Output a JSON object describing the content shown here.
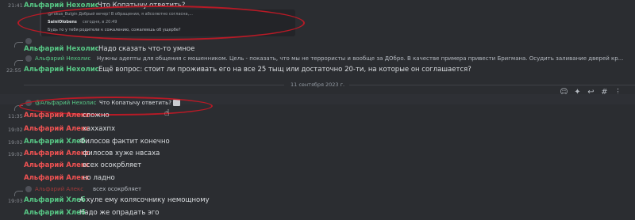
{
  "messages": [
    {
      "time": "21:41",
      "author": "Альфарий Нехолис",
      "text": "Что Копатычу ответить?"
    },
    {
      "embed_header": "@Fokus_Bulgin Добрый вечер! В обращении, я абсолютно согласна,...",
      "embed_user": "SainiOlobens",
      "embed_meta": "сегодня, в 20:49",
      "embed_body": "Будь то у тебя родители к сожалению, сожалеешь об ущербе?"
    },
    {
      "reply_author": "Альфарий Нехолис",
      "author": "Альфарий Нехолис",
      "text": "Надо сказать что-то умное"
    },
    {
      "reply_author": "Альфарий Нехолис",
      "reply_text": "Нужны адепты для общения с мошенником. Цель - показать, что мы не террористы и вообще за ДОбро. В качестве примера привести Бригмана. Осудить заливание дверей кр..."
    },
    {
      "time": "22:55",
      "author": "Альфарий Нехолис",
      "text": "Ещё вопрос: стоит ли проживать его на все 25 тыщ или достаточно 20-ти, на которые он соглашается?"
    },
    {
      "divider": "11 сентября 2023 г."
    },
    {
      "reply_author": "@Альфарий Нехолис",
      "reply_text": "Что Копатычу ответить?"
    },
    {
      "time": "11:35",
      "author": "Альфарий Алекс",
      "text": "сложно"
    },
    {
      "time": "19:02",
      "author": "Альфарий Алекс",
      "text": "хаххахпх"
    },
    {
      "time": "19:02",
      "author": "Альфарий Хлеб",
      "text": "Филосов фактит конечно"
    },
    {
      "time": "19:02",
      "author": "Альфарий Алекс",
      "text": "филосов хуже нвсаха"
    },
    {
      "author": "Альфарий Алекс",
      "text": "всех осокрбляет"
    },
    {
      "author": "Альфарий Алекс",
      "text": "но ладно"
    },
    {
      "reply_author": "Альфарий Алекс",
      "reply_text": "всех осокрбляет"
    },
    {
      "time": "19:03",
      "author": "Альфарий Хлеб",
      "text": "А хуле ему колясочнику немощному"
    },
    {
      "author": "Альфарий Хлеб",
      "text": "Надо же опрадать эго"
    }
  ],
  "colors": {
    "green": "#57c785",
    "red": "#f05252",
    "annotation": "#b81a26",
    "background": "#2b2d31"
  },
  "toolbar_icons": [
    "add-reaction-icon",
    "react-icon",
    "reply-icon",
    "hashtag-icon",
    "more-icon"
  ]
}
